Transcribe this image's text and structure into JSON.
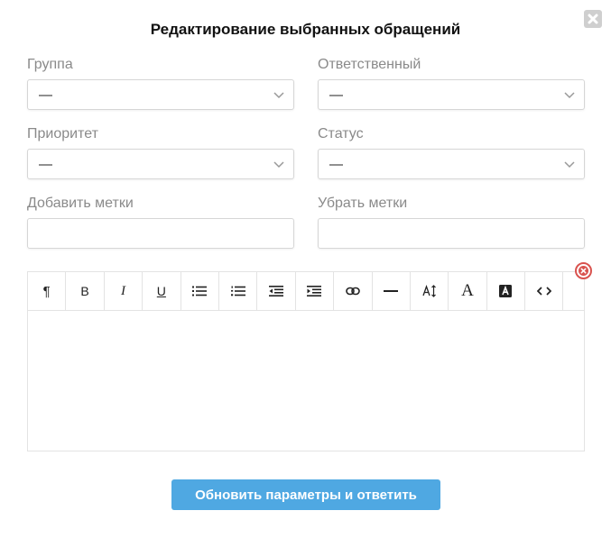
{
  "dialog": {
    "title": "Редактирование выбранных обращений"
  },
  "fields": {
    "group": {
      "label": "Группа",
      "value": "—"
    },
    "responsible": {
      "label": "Ответственный",
      "value": "—"
    },
    "priority": {
      "label": "Приоритет",
      "value": "—"
    },
    "status": {
      "label": "Статус",
      "value": "—"
    },
    "add_tags": {
      "label": "Добавить метки",
      "value": ""
    },
    "remove_tags": {
      "label": "Убрать метки",
      "value": ""
    }
  },
  "toolbar": {
    "paragraph": "¶",
    "bold": "B",
    "italic": "I",
    "underline": "U",
    "font": "A",
    "icons": [
      "paragraph-icon",
      "bold-icon",
      "italic-icon",
      "underline-icon",
      "unordered-list-icon",
      "ordered-list-icon",
      "outdent-icon",
      "indent-icon",
      "link-icon",
      "horizontal-rule-icon",
      "font-size-icon",
      "font-family-icon",
      "font-color-icon",
      "code-view-icon"
    ]
  },
  "buttons": {
    "submit": "Обновить параметры и ответить"
  },
  "colors": {
    "accent": "#4fa8e2",
    "remove_red": "#d9534f",
    "close_bg": "#cfcfcf"
  }
}
